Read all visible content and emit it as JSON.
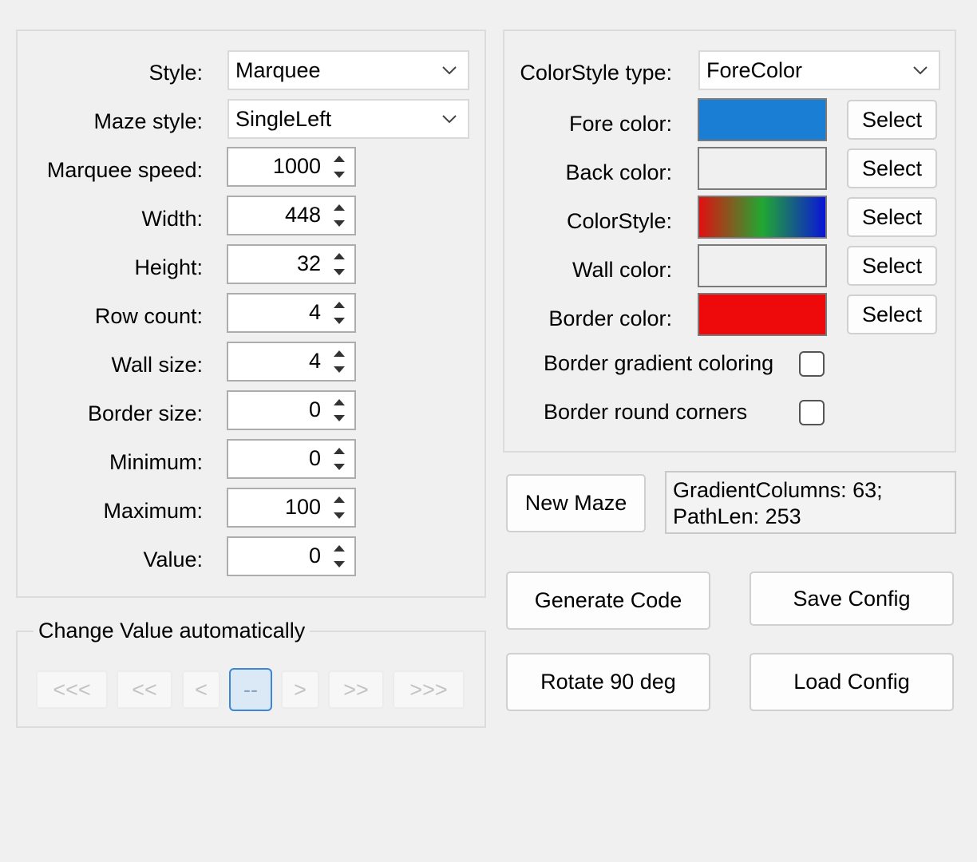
{
  "left_panel": {
    "style": {
      "label": "Style:",
      "value": "Marquee"
    },
    "maze_style": {
      "label": "Maze style:",
      "value": "SingleLeft"
    },
    "numeric_fields": [
      {
        "label": "Marquee speed:",
        "value": "1000"
      },
      {
        "label": "Width:",
        "value": "448"
      },
      {
        "label": "Height:",
        "value": "32"
      },
      {
        "label": "Row count:",
        "value": "4"
      },
      {
        "label": "Wall size:",
        "value": "4"
      },
      {
        "label": "Border size:",
        "value": "0"
      },
      {
        "label": "Minimum:",
        "value": "0"
      },
      {
        "label": "Maximum:",
        "value": "100"
      },
      {
        "label": "Value:",
        "value": "0"
      }
    ]
  },
  "change_value": {
    "title": "Change Value automatically",
    "buttons": [
      "<<<",
      "<<",
      "<",
      "--",
      ">",
      ">>",
      ">>>"
    ]
  },
  "color_panel": {
    "colorstyle_type": {
      "label": "ColorStyle type:",
      "value": "ForeColor"
    },
    "colors": [
      {
        "label": "Fore color:",
        "button": "Select",
        "color": "#1a7fd4"
      },
      {
        "label": "Back color:",
        "button": "Select",
        "color": "#f0f0f0"
      },
      {
        "label": "ColorStyle:",
        "button": "Select",
        "gradient": [
          "#e01010",
          "#22a832",
          "#0a14d8"
        ]
      },
      {
        "label": "Wall color:",
        "button": "Select",
        "color": "#f0f0f0"
      },
      {
        "label": "Border color:",
        "button": "Select",
        "color": "#ee0a0a"
      }
    ],
    "border_gradient_label": "Border gradient coloring",
    "border_gradient_checked": false,
    "border_round_label": "Border round corners",
    "border_round_checked": false
  },
  "actions": {
    "new_maze": "New Maze",
    "info_line1": "GradientColumns: 63;",
    "info_line2": "PathLen: 253",
    "generate_code": "Generate Code",
    "save_config": "Save Config",
    "rotate": "Rotate 90 deg",
    "load_config": "Load Config"
  }
}
